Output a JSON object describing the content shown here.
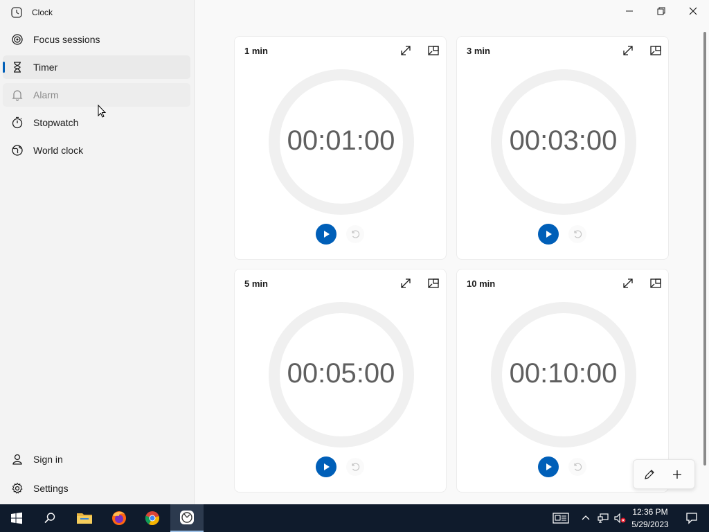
{
  "app": {
    "title": "Clock"
  },
  "sidebar": {
    "items": [
      {
        "label": "Focus sessions",
        "icon": "focus-icon"
      },
      {
        "label": "Timer",
        "icon": "hourglass-icon",
        "selected": true
      },
      {
        "label": "Alarm",
        "icon": "bell-icon"
      },
      {
        "label": "Stopwatch",
        "icon": "stopwatch-icon"
      },
      {
        "label": "World clock",
        "icon": "globe-icon"
      }
    ],
    "footer": [
      {
        "label": "Sign in",
        "icon": "person-icon"
      },
      {
        "label": "Settings",
        "icon": "gear-icon"
      }
    ]
  },
  "timers": [
    {
      "name": "1 min",
      "time": "00:01:00"
    },
    {
      "name": "3 min",
      "time": "00:03:00"
    },
    {
      "name": "5 min",
      "time": "00:05:00"
    },
    {
      "name": "10 min",
      "time": "00:10:00"
    }
  ],
  "taskbar": {
    "clock_time": "12:36 PM",
    "clock_date": "5/29/2023",
    "apps": [
      "start-icon",
      "search-icon",
      "file-explorer-icon",
      "firefox-icon",
      "chrome-icon",
      "clock-app-icon"
    ]
  },
  "colors": {
    "accent": "#005fb8",
    "taskbar": "#0f1b2c",
    "sidebar": "#f3f3f3",
    "time_text": "#5f5f5f"
  }
}
